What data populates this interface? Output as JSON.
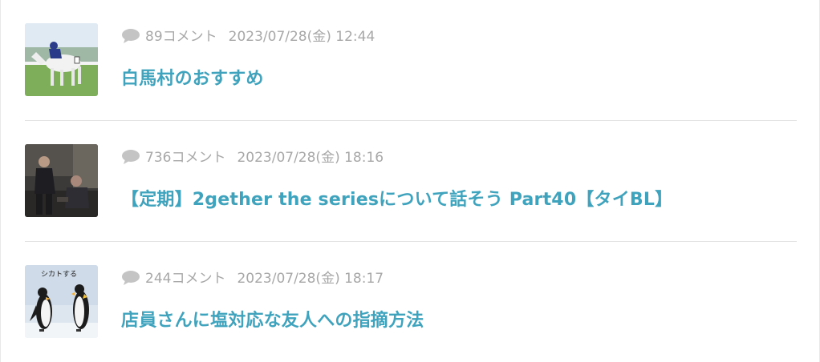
{
  "threads": [
    {
      "count": "89コメント",
      "datetime": "2023/07/28(金) 12:44",
      "title": "白馬村のおすすめ",
      "thumbnail": "white-horse-racing-photo"
    },
    {
      "count": "736コメント",
      "datetime": "2023/07/28(金) 18:16",
      "title": "【定期】2gether the seriesについて話そう Part40【タイBL】",
      "thumbnail": "two-men-sitting-photo"
    },
    {
      "count": "244コメント",
      "datetime": "2023/07/28(金) 18:17",
      "title": "店員さんに塩対応な友人への指摘方法",
      "thumbnail": "penguins-photo",
      "thumbnail_caption": "シカトする"
    }
  ],
  "icons": {
    "comment": "speech-bubble-icon"
  },
  "colors": {
    "title": "#3fa3bd",
    "meta": "#a8a8a8",
    "divider": "#e3e3e3"
  }
}
